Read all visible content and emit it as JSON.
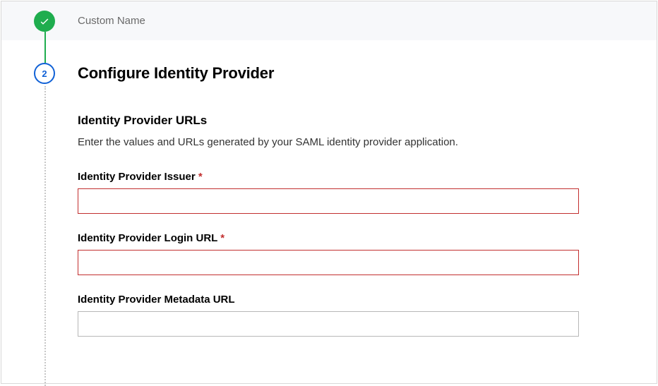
{
  "step1": {
    "label": "Custom Name"
  },
  "step2": {
    "number": "2",
    "title": "Configure Identity Provider"
  },
  "section": {
    "title": "Identity Provider URLs",
    "description": "Enter the values and URLs generated by your SAML identity provider application."
  },
  "fields": {
    "issuer": {
      "label": "Identity Provider Issuer",
      "required": "*",
      "value": ""
    },
    "login_url": {
      "label": "Identity Provider Login URL",
      "required": "*",
      "value": ""
    },
    "metadata_url": {
      "label": "Identity Provider Metadata URL",
      "value": ""
    }
  }
}
